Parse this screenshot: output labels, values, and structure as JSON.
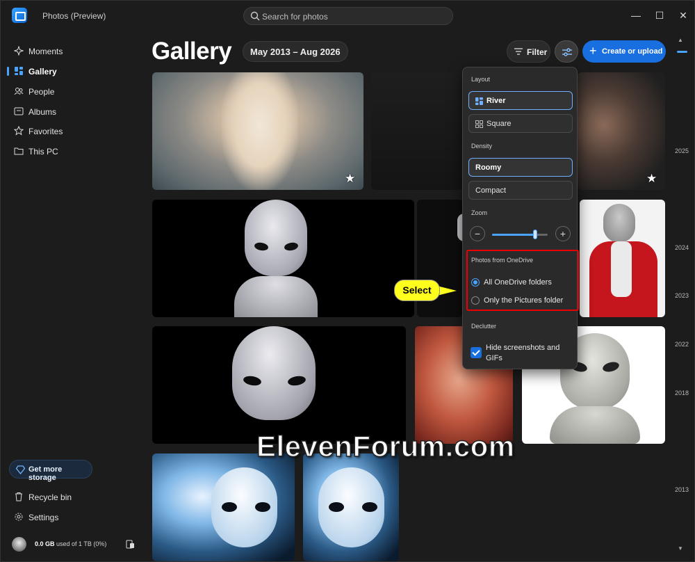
{
  "window": {
    "title": "Photos (Preview)"
  },
  "search": {
    "placeholder": "Search for photos"
  },
  "sidebar": {
    "items": [
      {
        "label": "Moments",
        "icon": "moments-icon"
      },
      {
        "label": "Gallery",
        "icon": "gallery-icon",
        "active": true
      },
      {
        "label": "People",
        "icon": "people-icon"
      },
      {
        "label": "Albums",
        "icon": "albums-icon"
      },
      {
        "label": "Favorites",
        "icon": "star-icon"
      },
      {
        "label": "This PC",
        "icon": "folder-icon"
      }
    ],
    "storage_button": "Get more storage",
    "recycle_bin": "Recycle bin",
    "settings": "Settings",
    "usage_amount": "0.0 GB",
    "usage_rest": " used of 1 TB (0%)"
  },
  "header": {
    "title": "Gallery",
    "date_range": "May 2013 – Aug 2026",
    "filter": "Filter",
    "create": "Create or upload"
  },
  "flyout": {
    "layout_heading": "Layout",
    "layout_options": [
      "River",
      "Square"
    ],
    "layout_selected": "River",
    "density_heading": "Density",
    "density_options": [
      "Roomy",
      "Compact"
    ],
    "density_selected": "Roomy",
    "zoom_heading": "Zoom",
    "zoom_level": 0.78,
    "onedrive_heading": "Photos from OneDrive",
    "onedrive_options": [
      "All OneDrive folders",
      "Only the Pictures folder"
    ],
    "onedrive_selected": "All OneDrive folders",
    "declutter_heading": "Declutter",
    "declutter_option": "Hide screenshots and GIFs",
    "declutter_checked": true
  },
  "timeline": {
    "years": [
      "2025",
      "2024",
      "2023",
      "2022",
      "2018",
      "2013"
    ]
  },
  "callout": "Select",
  "watermark": "ElevenForum.com",
  "colors": {
    "accent": "#1a6fe0",
    "callout": "#ffff1e",
    "highlight_box": "#e00000"
  }
}
